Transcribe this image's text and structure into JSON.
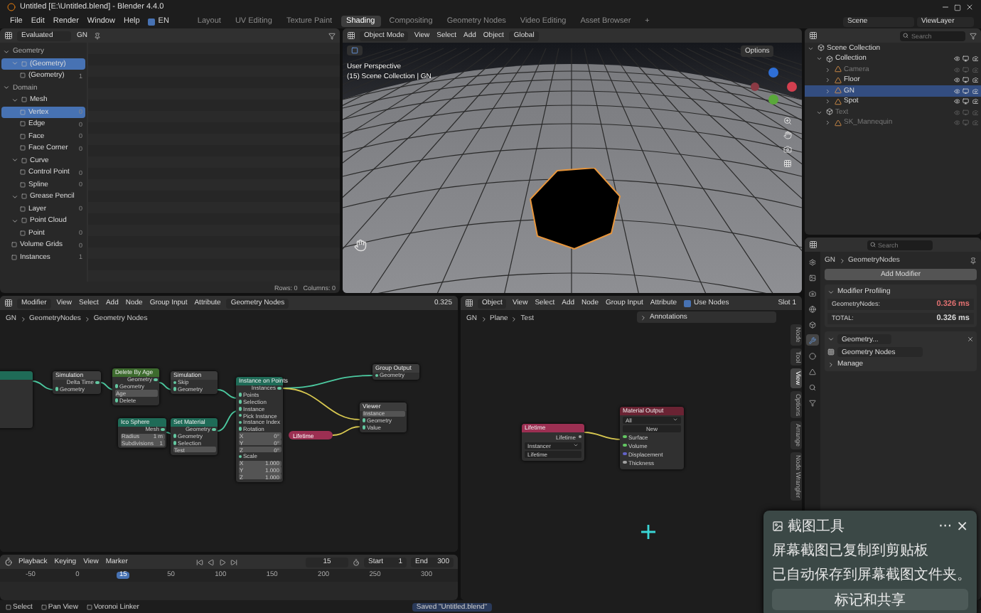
{
  "window": {
    "title": "Untitled [E:\\Untitled.blend] - Blender 4.4.0"
  },
  "menu": [
    "File",
    "Edit",
    "Render",
    "Window",
    "Help"
  ],
  "language": {
    "label": "EN",
    "checked": true
  },
  "workspaces": [
    {
      "label": "Layout",
      "selected": false
    },
    {
      "label": "UV Editing",
      "selected": false
    },
    {
      "label": "Texture Paint",
      "selected": false
    },
    {
      "label": "Shading",
      "selected": true
    },
    {
      "label": "Compositing",
      "selected": false
    },
    {
      "label": "Geometry Nodes",
      "selected": false
    },
    {
      "label": "Video Editing",
      "selected": false
    },
    {
      "label": "Asset Browser",
      "selected": false
    },
    {
      "label": "+",
      "selected": false
    }
  ],
  "scene": "Scene",
  "view_layer": "ViewLayer",
  "spreadsheet": {
    "mode": "Evaluated",
    "object": "GN",
    "tree": [
      {
        "label": "Geometry",
        "children": [
          {
            "label": "(Geometry)",
            "selected": true,
            "children": [
              {
                "label": "(Geometry)",
                "count": "1",
                "selected": false
              }
            ]
          }
        ]
      },
      {
        "label": "Domain",
        "children": [
          {
            "label": "Mesh",
            "selected": false,
            "children": [
              {
                "label": "Vertex",
                "count": "0",
                "selected": true
              },
              {
                "label": "Edge",
                "count": "0",
                "selected": false
              },
              {
                "label": "Face",
                "count": "0",
                "selected": false
              },
              {
                "label": "Face Corner",
                "count": "0",
                "selected": false
              }
            ]
          },
          {
            "label": "Curve",
            "selected": false,
            "children": [
              {
                "label": "Control Point",
                "count": "0",
                "selected": false
              },
              {
                "label": "Spline",
                "count": "0",
                "selected": false
              }
            ]
          },
          {
            "label": "Grease Pencil",
            "selected": false,
            "children": [
              {
                "label": "Layer",
                "count": "0",
                "selected": false
              }
            ]
          },
          {
            "label": "Point Cloud",
            "selected": false,
            "children": [
              {
                "label": "Point",
                "count": "0",
                "selected": false
              }
            ]
          },
          {
            "label": "Volume Grids",
            "count": "0",
            "selected": false
          },
          {
            "label": "Instances",
            "count": "1",
            "selected": false
          }
        ]
      }
    ],
    "rows": "Rows: 0",
    "columns": "Columns: 0"
  },
  "viewport": {
    "mode": "Object Mode",
    "menu": [
      "View",
      "Select",
      "Add",
      "Object"
    ],
    "orientation": "Global",
    "options": "Options",
    "perspective": "User Perspective",
    "info": "(15) Scene Collection | GN"
  },
  "outliner": {
    "search": {
      "placeholder": "Search"
    },
    "tree": [
      {
        "label": "Scene Collection",
        "selected": false,
        "dimmed": false,
        "expanded": true,
        "children": [
          {
            "label": "Collection",
            "selected": false,
            "dimmed": false,
            "expanded": true,
            "children": [
              {
                "label": "Camera",
                "selected": false,
                "dimmed": true,
                "expanded": false
              },
              {
                "label": "Floor",
                "selected": false,
                "dimmed": false,
                "expanded": false
              },
              {
                "label": "GN",
                "selected": true,
                "dimmed": false,
                "expanded": false
              },
              {
                "label": "Spot",
                "selected": false,
                "dimmed": false,
                "expanded": false
              }
            ]
          },
          {
            "label": "Text",
            "selected": false,
            "dimmed": true,
            "expanded": true,
            "children": [
              {
                "label": "SK_Mannequin",
                "selected": false,
                "dimmed": true,
                "expanded": false
              }
            ]
          }
        ]
      }
    ]
  },
  "properties": {
    "search": {
      "placeholder": "Search"
    },
    "breadcrumb": [
      "GN",
      "GeometryNodes"
    ],
    "add_modifier": "Add Modifier",
    "tabs": [
      {
        "selected": false
      },
      {
        "selected": false
      },
      {
        "selected": false
      },
      {
        "selected": false
      },
      {
        "selected": false
      },
      {
        "selected": true
      },
      {
        "selected": false
      },
      {
        "selected": false
      },
      {
        "selected": false
      },
      {
        "selected": false
      }
    ],
    "profiling": {
      "title": "Modifier Profiling",
      "rows": [
        {
          "label": "GeometryNodes:",
          "value": "0.326 ms",
          "color": "#e07070"
        },
        {
          "label": "TOTAL:",
          "value": "0.326 ms",
          "color": "#d8d8d8"
        }
      ]
    },
    "modifier": {
      "name": "Geometry...",
      "node_group": "Geometry Nodes",
      "manage": "Manage"
    }
  },
  "geometry_nodes_editor": {
    "context": "Modifier",
    "menu": [
      "View",
      "Select",
      "Add",
      "Node",
      "Group Input",
      "Attribute"
    ],
    "tree_name": "Geometry Nodes",
    "timing": "0.325",
    "breadcrumb": [
      "GN",
      "GeometryNodes",
      "Geometry Nodes"
    ],
    "nodes": [
      {
        "kind": "node",
        "color": "#1f6b57"
      },
      {
        "kind": "node",
        "title": "Simulation",
        "color": "#3c3c3c",
        "sockets": [
          {
            "label": "Delta Time",
            "kind": "output"
          },
          {
            "label": "Geometry",
            "kind": "input"
          }
        ]
      },
      {
        "kind": "node",
        "title": "Delete By Age",
        "color": "#3d6b2e",
        "sockets": [
          {
            "label": "Geometry",
            "kind": "output"
          },
          {
            "label": "Geometry",
            "kind": "input"
          },
          {
            "label": "Age",
            "kind": "field"
          },
          {
            "label": "Delete",
            "kind": "input"
          }
        ]
      },
      {
        "kind": "node",
        "title": "Simulation",
        "color": "#3c3c3c",
        "sockets": [
          {
            "label": "Skip",
            "kind": "input"
          },
          {
            "label": "Geometry",
            "kind": "input"
          }
        ]
      },
      {
        "kind": "node",
        "title": "Ico Sphere",
        "color": "#1f6b57",
        "sockets": [
          {
            "label": "Mesh",
            "kind": "output"
          },
          {
            "label": "Radius",
            "value": "1 m",
            "kind": "field"
          },
          {
            "label": "Subdivisions",
            "value": "1",
            "kind": "field"
          }
        ]
      },
      {
        "kind": "node",
        "title": "Set Material",
        "color": "#1f6b57",
        "sockets": [
          {
            "label": "Geometry",
            "kind": "output"
          },
          {
            "label": "Geometry",
            "kind": "input"
          },
          {
            "label": "Selection",
            "kind": "input"
          },
          {
            "label": "Test",
            "kind": "field"
          }
        ]
      },
      {
        "kind": "node",
        "title": "Instance on Points",
        "color": "#1f6b57",
        "sockets": [
          {
            "label": "Instances",
            "kind": "output"
          },
          {
            "label": "Points",
            "kind": "input"
          },
          {
            "label": "Selection",
            "kind": "input"
          },
          {
            "label": "Instance",
            "kind": "input"
          },
          {
            "label": "Pick Instance",
            "kind": "input"
          },
          {
            "label": "Instance Index",
            "kind": "input"
          },
          {
            "label": "Rotation",
            "kind": "input"
          },
          {
            "label": "X",
            "value": "0°",
            "kind": "field"
          },
          {
            "label": "Y",
            "value": "0°",
            "kind": "field"
          },
          {
            "label": "Z",
            "value": "0°",
            "kind": "field"
          },
          {
            "label": "Scale",
            "kind": "input"
          },
          {
            "label": "X",
            "value": "1.000",
            "kind": "field"
          },
          {
            "label": "Y",
            "value": "1.000",
            "kind": "field"
          },
          {
            "label": "Z",
            "value": "1.000",
            "kind": "field"
          }
        ]
      },
      {
        "kind": "reroute",
        "title": "Lifetime",
        "color": "#9c2f52"
      },
      {
        "kind": "node",
        "title": "Group Output",
        "color": "#3c3c3c",
        "sockets": [
          {
            "label": "Geometry",
            "kind": "input"
          }
        ]
      },
      {
        "kind": "node",
        "title": "Viewer",
        "color": "#3c3c3c",
        "sockets": [
          {
            "label": "Instance",
            "kind": "field"
          },
          {
            "label": "Geometry",
            "kind": "input"
          },
          {
            "label": "Value",
            "kind": "input"
          }
        ]
      }
    ]
  },
  "shader_editor": {
    "context": "Object",
    "menu": [
      "View",
      "Select",
      "Add",
      "Node",
      "Group Input",
      "Attribute"
    ],
    "use_nodes": {
      "label": "Use Nodes",
      "checked": true
    },
    "slot": "Slot 1",
    "breadcrumb": [
      "GN",
      "Plane",
      "Test"
    ],
    "annotations": "Annotations",
    "side_tabs": [
      {
        "label": "Node",
        "selected": false
      },
      {
        "label": "Tool",
        "selected": false
      },
      {
        "label": "View",
        "selected": true
      },
      {
        "label": "Options",
        "selected": false
      },
      {
        "label": "Arrange",
        "selected": false
      },
      {
        "label": "Node Wrangler",
        "selected": false
      }
    ],
    "attribute_node": {
      "title": "Lifetime",
      "color": "#9c2f52",
      "output": "Lifetime",
      "type": "Instancer",
      "name": "Lifetime"
    },
    "output_node": {
      "title": "Material Output",
      "color": "#6a2333",
      "target": "All",
      "material": "New",
      "inputs": [
        {
          "label": "Surface",
          "color": "#63c763"
        },
        {
          "label": "Volume",
          "color": "#63c763"
        },
        {
          "label": "Displacement",
          "color": "#6363c7"
        },
        {
          "label": "Thickness",
          "color": "#a1a1a1"
        }
      ]
    }
  },
  "timeline": {
    "menu": [
      "Playback",
      "Keying",
      "View",
      "Marker"
    ],
    "frame": "15",
    "start_label": "Start",
    "start": "1",
    "end_label": "End",
    "end": "300",
    "ruler": [
      {
        "label": "-50",
        "selected": false
      },
      {
        "label": "0",
        "selected": false
      },
      {
        "label": "15",
        "selected": true
      },
      {
        "label": "50",
        "selected": false
      },
      {
        "label": "100",
        "selected": false
      },
      {
        "label": "150",
        "selected": false
      },
      {
        "label": "200",
        "selected": false
      },
      {
        "label": "250",
        "selected": false
      },
      {
        "label": "300",
        "selected": false
      }
    ]
  },
  "status_bar": {
    "hints": [
      "Select",
      "Pan View",
      "Voronoi Linker"
    ],
    "message": "Saved \"Untitled.blend\""
  },
  "notification": {
    "app": "截图工具",
    "more": "···",
    "close": "×",
    "lines": [
      "屏幕截图已复制到剪贴板",
      "已自动保存到屏幕截图文件夹。"
    ],
    "action": "标记和共享"
  }
}
